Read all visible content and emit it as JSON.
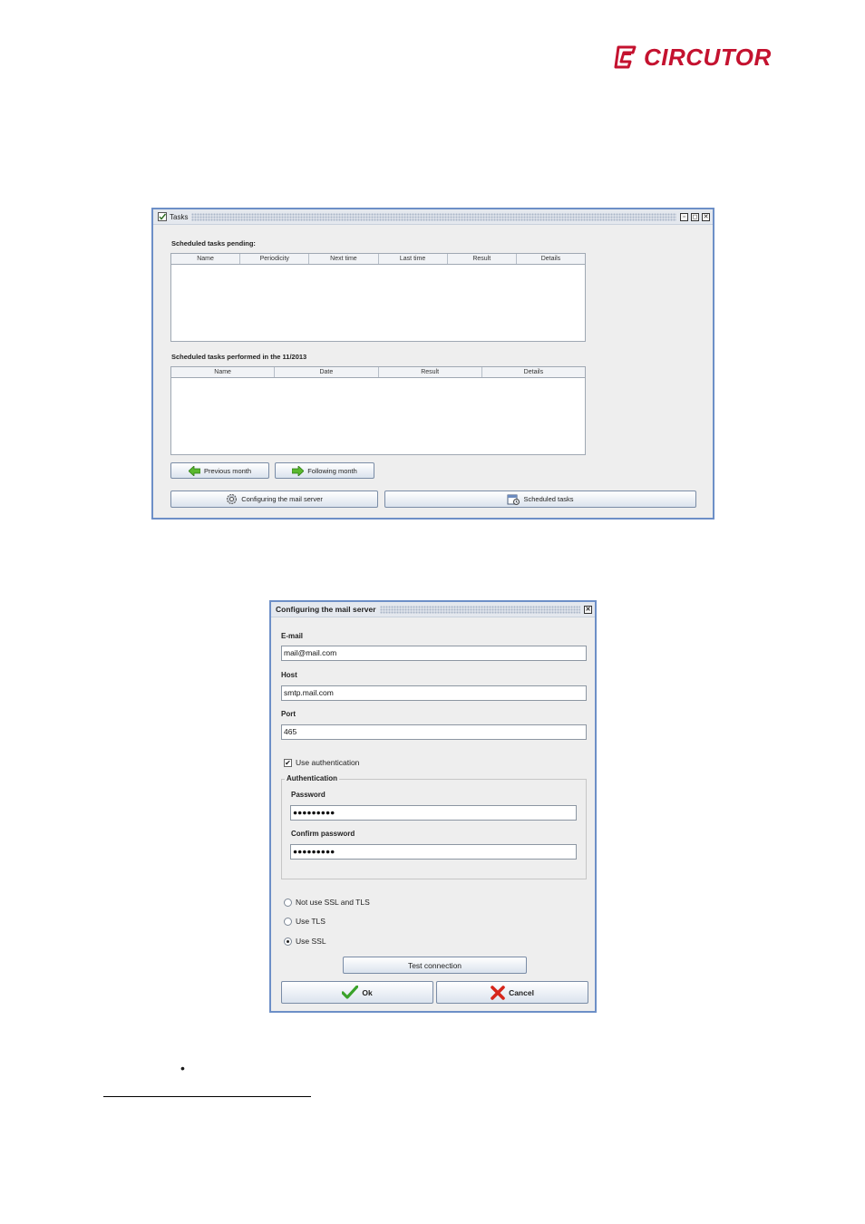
{
  "brand": {
    "name": "CIRCUTOR",
    "color": "#c4122f"
  },
  "tasks_window": {
    "title": "Tasks",
    "pending_label": "Scheduled tasks pending:",
    "pending_columns": [
      "Name",
      "Periodicity",
      "Next time",
      "Last time",
      "Result",
      "Details"
    ],
    "performed_label": "Scheduled tasks performed in the 11/2013",
    "performed_columns": [
      "Name",
      "Date",
      "Result",
      "Details"
    ],
    "prev_month": "Previous month",
    "next_month": "Following month",
    "config_mail": "Configuring the mail server",
    "scheduled_tasks": "Scheduled tasks",
    "icons": {
      "title": "checkbox-icon",
      "prev": "arrow-left-icon",
      "next": "arrow-right-icon",
      "config": "gear-icon",
      "scheduled": "calendar-icon"
    }
  },
  "mail_dialog": {
    "title": "Configuring the mail server",
    "email_label": "E-mail",
    "email_value": "mail@mail.com",
    "host_label": "Host",
    "host_value": "smtp.mail.com",
    "port_label": "Port",
    "port_value": "465",
    "use_auth_label": "Use authentication",
    "use_auth_checked": true,
    "auth_group": "Authentication",
    "password_label": "Password",
    "password_value": "●●●●●●●●●",
    "confirm_label": "Confirm password",
    "confirm_value": "●●●●●●●●●",
    "security_options": [
      "Not use SSL and TLS",
      "Use TLS",
      "Use SSL"
    ],
    "selected_security": "Use SSL",
    "test_button": "Test connection",
    "ok_button": "Ok",
    "cancel_button": "Cancel",
    "icons": {
      "ok": "checkmark-icon",
      "cancel": "x-icon"
    }
  },
  "footer": {
    "bullet": "•"
  }
}
